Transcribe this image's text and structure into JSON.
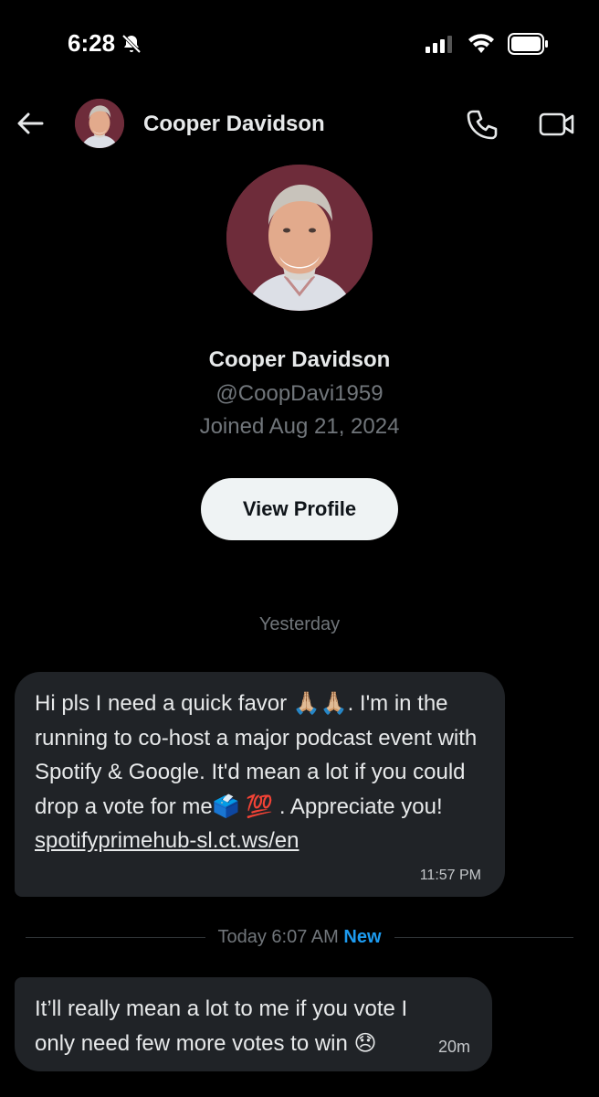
{
  "status_bar": {
    "time": "6:28",
    "icons": [
      "bell-slash-icon",
      "signal-icon",
      "wifi-icon",
      "battery-icon"
    ]
  },
  "header": {
    "name": "Cooper Davidson",
    "icons": [
      "back-arrow-icon",
      "phone-icon",
      "video-camera-icon"
    ]
  },
  "profile": {
    "name": "Cooper Davidson",
    "handle": "@CoopDavi1959",
    "joined": "Joined Aug 21, 2024",
    "view_profile_label": "View Profile"
  },
  "conversation": {
    "date_separator": "Yesterday",
    "message_1": {
      "text_before_link": "Hi pls I need a quick favor 🙏🏼🙏🏼. I'm in the running to co-host a major podcast event with Spotify & Google. It'd mean a lot if you could drop a vote for me🗳️ 💯 . Appreciate you!",
      "link": "spotifyprimehub-sl.ct.ws/en",
      "time": "11:57 PM"
    },
    "today_separator": {
      "label": "Today 6:07 AM",
      "new_label": "New"
    },
    "message_2": {
      "text": "It’ll really mean a lot to me if you vote I only need few more votes to win 😞",
      "time": "20m"
    }
  },
  "colors": {
    "background": "#000000",
    "bubble": "#202327",
    "muted_text": "#71767b",
    "accent_blue": "#1d9bf0",
    "button_bg": "#eff3f4"
  }
}
